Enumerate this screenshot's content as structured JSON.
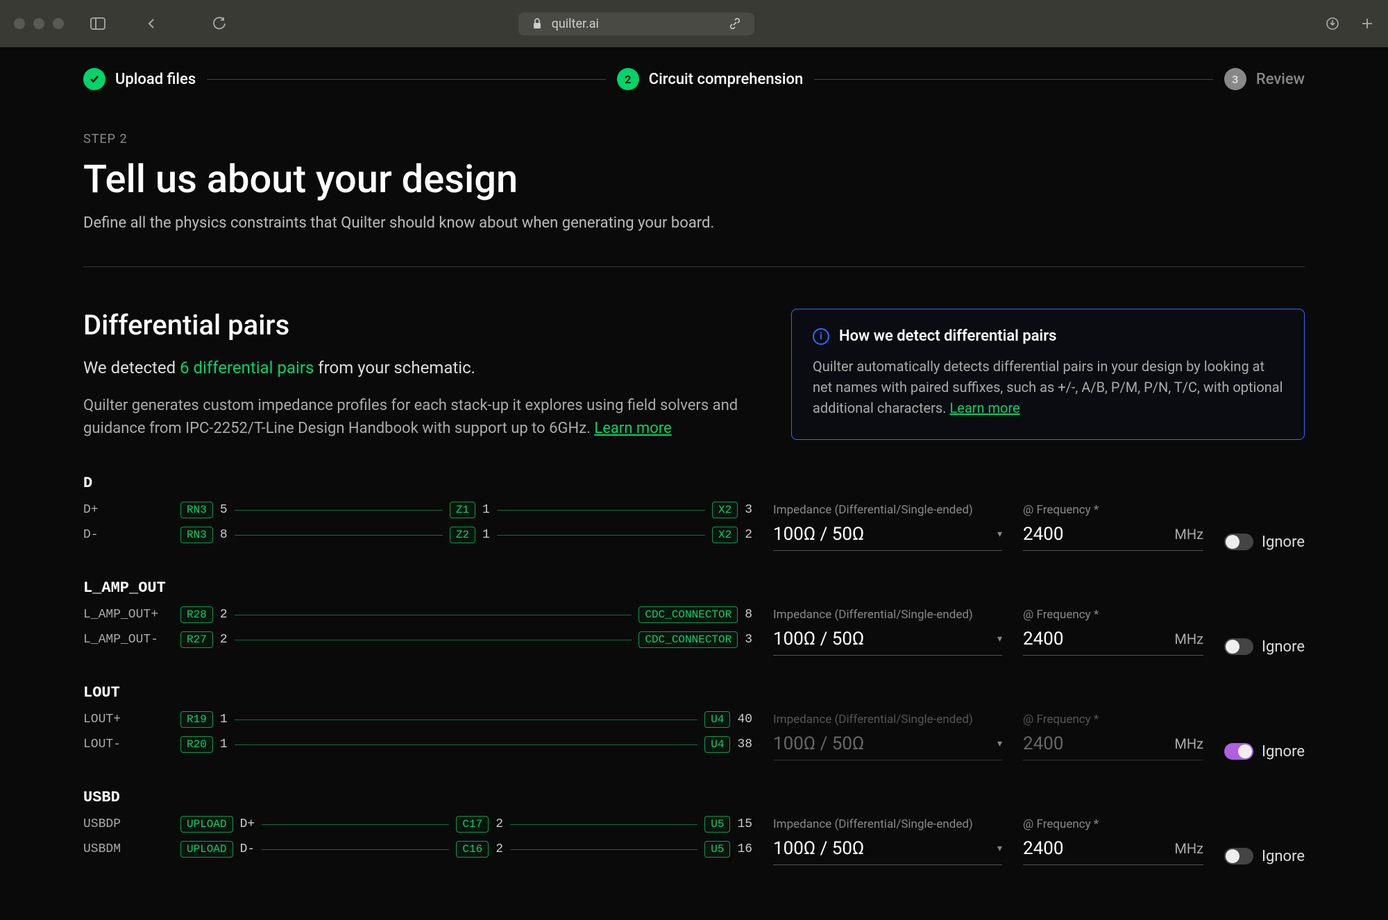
{
  "browser": {
    "url": "quilter.ai"
  },
  "stepper": {
    "step1": "Upload files",
    "step2_num": "2",
    "step2": "Circuit comprehension",
    "step3_num": "3",
    "step3": "Review"
  },
  "header": {
    "eyebrow": "STEP 2",
    "title": "Tell us about your design",
    "subtitle": "Define all the physics constraints that Quilter should know about when generating your board."
  },
  "diffpairs": {
    "title": "Differential pairs",
    "detected_prefix": "We detected ",
    "detected_count": "6 differential pairs",
    "detected_suffix": " from your schematic.",
    "desc": "Quilter generates custom impedance profiles for each stack-up it explores using field solvers and guidance from IPC-2252/T-Line Design Handbook with support up to 6GHz. ",
    "learn_more": "Learn more"
  },
  "info": {
    "title": "How we detect differential pairs",
    "body": "Quilter automatically detects differential pairs in your design by looking at net names with paired suffixes, such as +/-, A/B, P/M, P/N, T/C, with optional additional characters. ",
    "learn_more": "Learn more"
  },
  "labels": {
    "impedance": "Impedance (Differential/Single-ended)",
    "frequency": "@ Frequency *",
    "unit": "MHz",
    "ignore": "Ignore"
  },
  "pairs": [
    {
      "name": "D",
      "nets": [
        {
          "label": "D+",
          "a_chip": "RN3",
          "a_pin": "5",
          "mid_chip": "Z1",
          "mid_pin": "1",
          "b_chip": "X2",
          "b_pin": "3"
        },
        {
          "label": "D-",
          "a_chip": "RN3",
          "a_pin": "8",
          "mid_chip": "Z2",
          "mid_pin": "1",
          "b_chip": "X2",
          "b_pin": "2"
        }
      ],
      "impedance": "100Ω / 50Ω",
      "frequency": "2400",
      "ignore": false
    },
    {
      "name": "L_AMP_OUT",
      "nets": [
        {
          "label": "L_AMP_OUT+",
          "a_chip": "R28",
          "a_pin": "2",
          "b_chip": "CDC_CONNECTOR",
          "b_pin": "8"
        },
        {
          "label": "L_AMP_OUT-",
          "a_chip": "R27",
          "a_pin": "2",
          "b_chip": "CDC_CONNECTOR",
          "b_pin": "3"
        }
      ],
      "impedance": "100Ω / 50Ω",
      "frequency": "2400",
      "ignore": false
    },
    {
      "name": "LOUT",
      "nets": [
        {
          "label": "LOUT+",
          "a_chip": "R19",
          "a_pin": "1",
          "b_chip": "U4",
          "b_pin": "40"
        },
        {
          "label": "LOUT-",
          "a_chip": "R20",
          "a_pin": "1",
          "b_chip": "U4",
          "b_pin": "38"
        }
      ],
      "impedance": "100Ω / 50Ω",
      "frequency": "2400",
      "ignore": true
    },
    {
      "name": "USBD",
      "nets": [
        {
          "label": "USBDP",
          "a_chip": "UPLOAD",
          "a_pin": "D+",
          "mid_chip": "C17",
          "mid_pin": "2",
          "b_chip": "U5",
          "b_pin": "15"
        },
        {
          "label": "USBDM",
          "a_chip": "UPLOAD",
          "a_pin": "D-",
          "mid_chip": "C16",
          "mid_pin": "2",
          "b_chip": "U5",
          "b_pin": "16"
        }
      ],
      "impedance": "100Ω / 50Ω",
      "frequency": "2400",
      "ignore": false
    }
  ]
}
